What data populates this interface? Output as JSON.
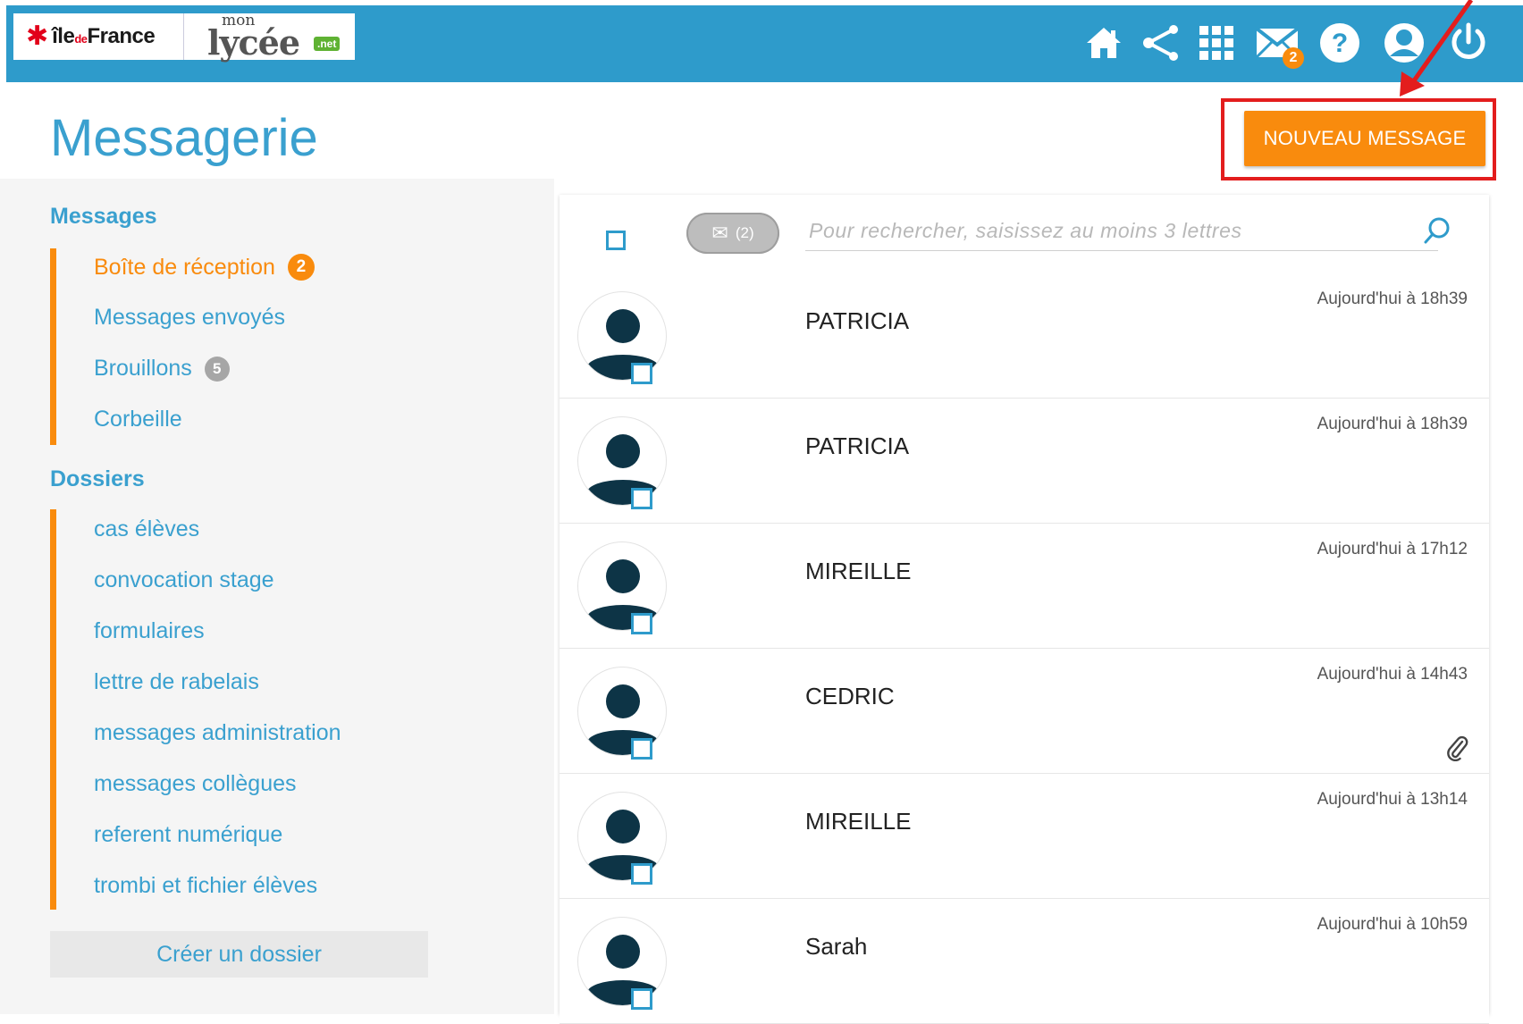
{
  "header": {
    "logo_idf": {
      "prefix": "île",
      "mid": "de",
      "suffix": "France"
    },
    "logo_lycee": {
      "mon": "mon",
      "word": "lycée",
      "net": ".net"
    },
    "icons": [
      "home-icon",
      "share-icon",
      "apps-grid-icon",
      "mail-icon",
      "help-icon",
      "account-icon",
      "power-icon"
    ],
    "mail_count": "2",
    "bar_color": "#2e9bcb"
  },
  "page": {
    "title": "Messagerie",
    "new_message_label": "NOUVEAU MESSAGE",
    "accent": "#f98b0d",
    "link_color": "#3aa0cf"
  },
  "sidebar": {
    "messages_title": "Messages",
    "messages": [
      {
        "label": "Boîte de réception",
        "badge": "2",
        "active": true
      },
      {
        "label": "Messages envoyés",
        "badge": ""
      },
      {
        "label": "Brouillons",
        "badge": "5"
      },
      {
        "label": "Corbeille",
        "badge": ""
      }
    ],
    "folders_title": "Dossiers",
    "folders": [
      {
        "label": "cas élèves"
      },
      {
        "label": "convocation stage"
      },
      {
        "label": "formulaires"
      },
      {
        "label": "lettre de rabelais"
      },
      {
        "label": "messages administration"
      },
      {
        "label": "messages collègues"
      },
      {
        "label": "referent numérique"
      },
      {
        "label": "trombi et fichier élèves"
      }
    ],
    "create_folder_label": "Créer un dossier"
  },
  "list": {
    "unread_filter_label": "(2)",
    "search_placeholder": "Pour rechercher, saisissez au moins 3 lettres",
    "messages": [
      {
        "sender": "PATRICIA",
        "time": "Aujourd'hui à 18h39",
        "attachment": false
      },
      {
        "sender": "PATRICIA",
        "time": "Aujourd'hui à 18h39",
        "attachment": false
      },
      {
        "sender": "MIREILLE",
        "time": "Aujourd'hui à 17h12",
        "attachment": false
      },
      {
        "sender": "CEDRIC",
        "time": "Aujourd'hui à 14h43",
        "attachment": true
      },
      {
        "sender": "MIREILLE",
        "time": "Aujourd'hui à 13h14",
        "attachment": false
      },
      {
        "sender": "Sarah",
        "time": "Aujourd'hui à 10h59",
        "attachment": false
      }
    ]
  }
}
